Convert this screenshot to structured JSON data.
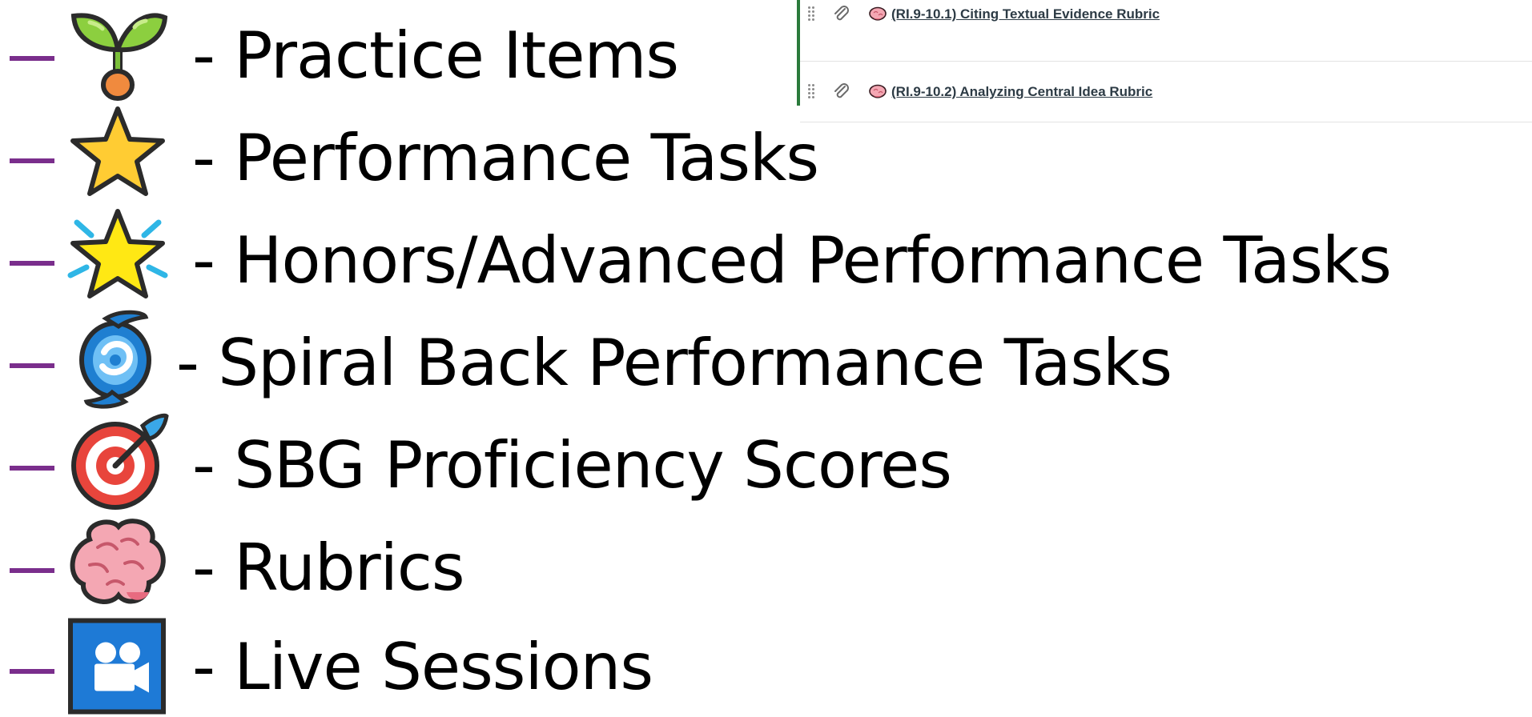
{
  "module_list": {
    "items": [
      {
        "title": "(RI.9-10.1) Citing Textual Evidence Rubric"
      },
      {
        "title": "(RI.9-10.2) Analyzing Central Idea Rubric"
      }
    ]
  },
  "legend": {
    "dash": "–",
    "items": [
      {
        "icon": "seedling-icon",
        "label": "- Practice Items"
      },
      {
        "icon": "star-icon",
        "label": "- Performance Tasks"
      },
      {
        "icon": "glowing-star-icon",
        "label": "- Honors/Advanced Performance Tasks"
      },
      {
        "icon": "cyclone-icon",
        "label": "- Spiral Back Performance Tasks"
      },
      {
        "icon": "direct-hit-icon",
        "label": "- SBG Proficiency Scores"
      },
      {
        "icon": "brain-icon",
        "label": "- Rubrics"
      },
      {
        "icon": "movie-camera-icon",
        "label": "- Live Sessions"
      }
    ]
  },
  "colors": {
    "dash": "#7a2e8c",
    "module_border": "#2a7a3b",
    "link_text": "#2d3b45"
  }
}
